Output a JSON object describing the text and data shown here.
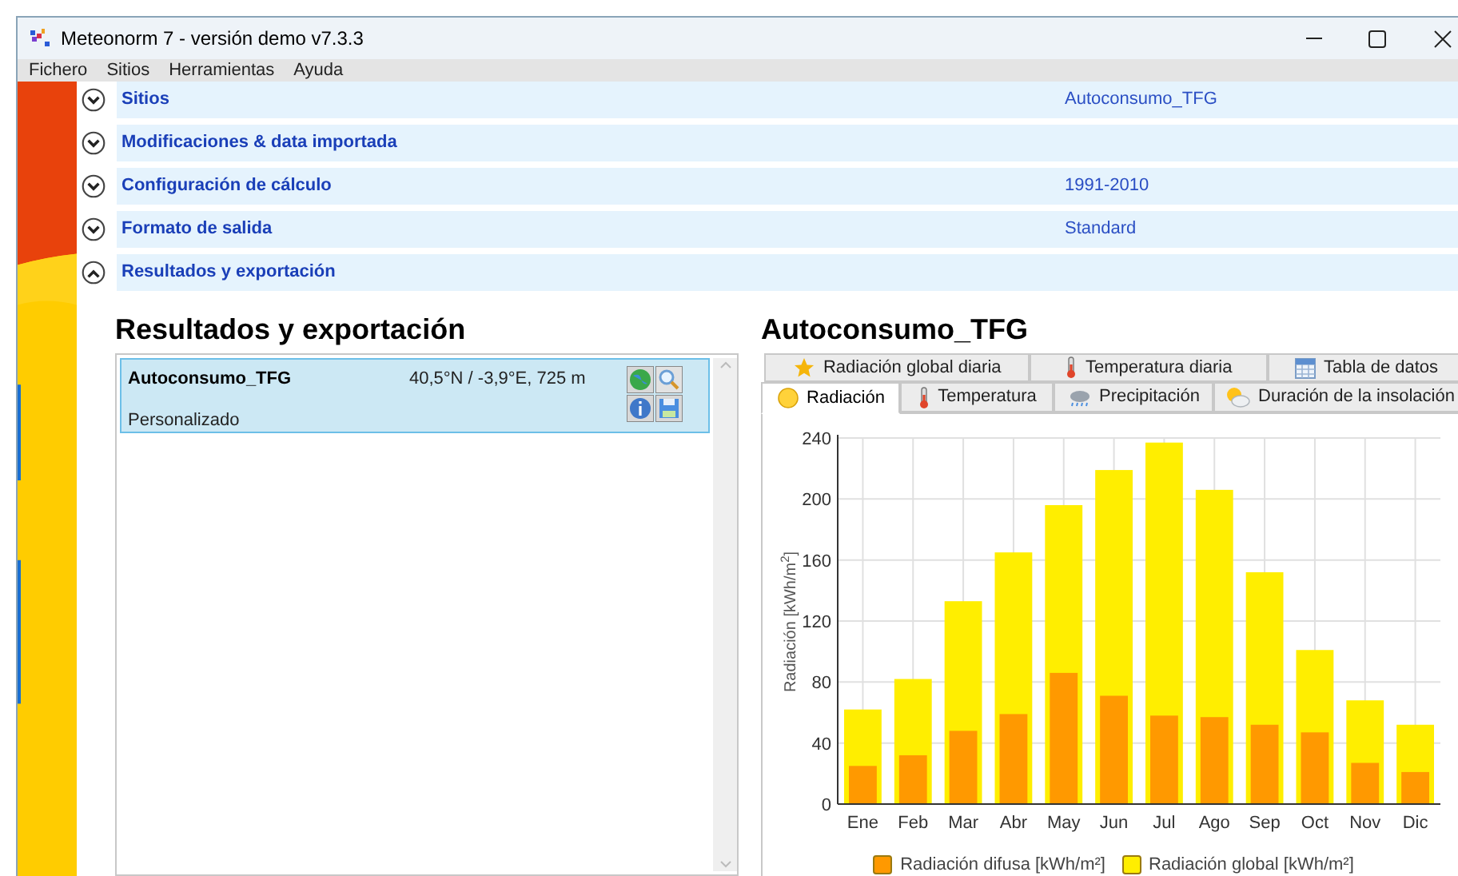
{
  "window": {
    "title": "Meteonorm 7 - versión demo v7.3.3"
  },
  "menu": [
    "Fichero",
    "Sitios",
    "Herramientas",
    "Ayuda"
  ],
  "sections": [
    {
      "label": "Sitios",
      "value": "Autoconsumo_TFG",
      "expanded": false
    },
    {
      "label": "Modificaciones & data importada",
      "expanded": false
    },
    {
      "label": "Configuración de cálculo",
      "value": "1991-2010",
      "expanded": false
    },
    {
      "label": "Formato de salida",
      "value": "Standard",
      "expanded": false
    },
    {
      "label": "Resultados y exportación",
      "expanded": true
    }
  ],
  "results": {
    "heading": "Resultados y exportación",
    "sites": [
      {
        "name": "Autoconsumo_TFG",
        "coords": "40,5°N / -3,9°E, 725 m",
        "type": "Personalizado",
        "selected": true
      }
    ]
  },
  "detail": {
    "title": "Autoconsumo_TFG",
    "tabs_row_1": [
      {
        "label": "Radiación global diaria",
        "selected": false
      },
      {
        "label": "Temperatura diaria",
        "selected": false
      },
      {
        "label": "Tabla de datos",
        "selected": false
      }
    ],
    "tabs_row_2": [
      {
        "label": "Radiación",
        "selected": true
      },
      {
        "label": "Temperatura",
        "selected": false
      },
      {
        "label": "Precipitación",
        "selected": false
      },
      {
        "label": "Duración de la insolación",
        "selected": false
      }
    ],
    "chart_data": {
      "type": "bar",
      "grid": true,
      "legend": true,
      "ylabel": "Radiación [kWh/m$^{2}$]",
      "categories": [
        "Ene",
        "Feb",
        "Mar",
        "Abr",
        "May",
        "Jun",
        "Jul",
        "Ago",
        "Sep",
        "Oct",
        "Nov",
        "Dic"
      ],
      "stacked": false,
      "ylim": [
        0,
        240
      ],
      "yticks": [
        0,
        40,
        80,
        120,
        160,
        200,
        240
      ],
      "series": [
        {
          "name": "Radiación difusa [kWh/m²]",
          "color": "#ff9900",
          "values": [
            25,
            32,
            48,
            59,
            86,
            71,
            58,
            57,
            52,
            47,
            27,
            21
          ]
        },
        {
          "name": "Radiación global [kWh/m²]",
          "color": "#ffee00",
          "values": [
            62,
            82,
            133,
            165,
            196,
            219,
            237,
            206,
            152,
            101,
            68,
            52
          ]
        }
      ]
    }
  }
}
